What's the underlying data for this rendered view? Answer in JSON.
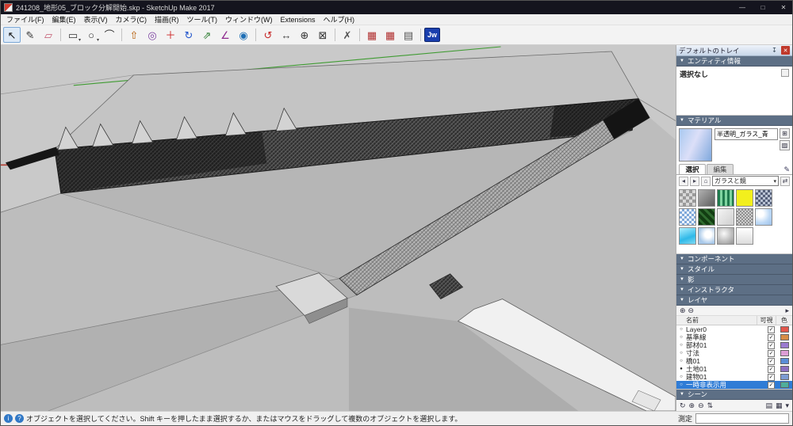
{
  "window": {
    "title": "241208_地形05_ブロック分解開始.skp - SketchUp Make 2017",
    "controls": {
      "minimize": "—",
      "maximize": "□",
      "close": "✕"
    }
  },
  "menu": {
    "items": [
      "ファイル(F)",
      "編集(E)",
      "表示(V)",
      "カメラ(C)",
      "描画(R)",
      "ツール(T)",
      "ウィンドウ(W)",
      "Extensions",
      "ヘルプ(H)"
    ]
  },
  "toolbar": {
    "items": [
      {
        "name": "select-tool",
        "glyph": "↖",
        "color": "#111111",
        "cls": "pressed",
        "inter": "true"
      },
      {
        "name": "line-tool",
        "glyph": "✎",
        "color": "#333333",
        "cls": "",
        "inter": "true"
      },
      {
        "name": "eraser-tool",
        "glyph": "▱",
        "color": "#c2566e",
        "cls": "",
        "inter": "true"
      },
      {
        "name": "toolbar-separator",
        "glyph": "",
        "color": "",
        "cls": "sep",
        "inter": "false"
      },
      {
        "name": "rectangle-tool",
        "glyph": "▭",
        "color": "#333333",
        "cls": "dd",
        "inter": "true"
      },
      {
        "name": "circle-tool",
        "glyph": "○",
        "color": "#333333",
        "cls": "dd",
        "inter": "true"
      },
      {
        "name": "arc-tool",
        "glyph": "⌒",
        "color": "#333333",
        "cls": "",
        "inter": "true"
      },
      {
        "name": "toolbar-separator",
        "glyph": "",
        "color": "",
        "cls": "sep",
        "inter": "false"
      },
      {
        "name": "pushpull-tool",
        "glyph": "⇧",
        "color": "#b35900",
        "cls": "",
        "inter": "true"
      },
      {
        "name": "offset-tool",
        "glyph": "◎",
        "color": "#7a3fa0",
        "cls": "",
        "inter": "true"
      },
      {
        "name": "move-tool",
        "glyph": "＋",
        "color": "#cc2222",
        "cls": "",
        "inter": "true"
      },
      {
        "name": "rotate-tool",
        "glyph": "↻",
        "color": "#2255cc",
        "cls": "",
        "inter": "true"
      },
      {
        "name": "scale-tool",
        "glyph": "⇗",
        "color": "#2e7d32",
        "cls": "",
        "inter": "true"
      },
      {
        "name": "tape-measure-tool",
        "glyph": "∠",
        "color": "#8e2a8e",
        "cls": "",
        "inter": "true"
      },
      {
        "name": "paint-bucket-tool",
        "glyph": "◉",
        "color": "#1f6fb5",
        "cls": "",
        "inter": "true"
      },
      {
        "name": "toolbar-separator",
        "glyph": "",
        "color": "",
        "cls": "sep",
        "inter": "false"
      },
      {
        "name": "orbit-tool",
        "glyph": "↺",
        "color": "#c62828",
        "cls": "",
        "inter": "true"
      },
      {
        "name": "pan-tool",
        "glyph": "↔",
        "color": "#444444",
        "cls": "",
        "inter": "true"
      },
      {
        "name": "zoom-tool",
        "glyph": "⊕",
        "color": "#333333",
        "cls": "",
        "inter": "true"
      },
      {
        "name": "zoom-extents-tool",
        "glyph": "⊠",
        "color": "#333333",
        "cls": "",
        "inter": "true"
      },
      {
        "name": "toolbar-separator",
        "glyph": "",
        "color": "",
        "cls": "sep",
        "inter": "false"
      },
      {
        "name": "delete-guides-tool",
        "glyph": "✗",
        "color": "#555555",
        "cls": "",
        "inter": "true"
      },
      {
        "name": "toolbar-separator",
        "glyph": "",
        "color": "",
        "cls": "sep",
        "inter": "false"
      },
      {
        "name": "plugin-cube-icon",
        "glyph": "▦",
        "color": "#b03030",
        "cls": "",
        "inter": "true"
      },
      {
        "name": "plugin-cube-icon-2",
        "glyph": "▦",
        "color": "#b03030",
        "cls": "",
        "inter": "true"
      },
      {
        "name": "export-icon",
        "glyph": "▤",
        "color": "#555555",
        "cls": "",
        "inter": "true"
      },
      {
        "name": "toolbar-separator",
        "glyph": "",
        "color": "",
        "cls": "sep",
        "inter": "false"
      },
      {
        "name": "jw-cad-button",
        "glyph": "Jw",
        "color": "#ffffff",
        "cls": "jw",
        "inter": "true"
      }
    ]
  },
  "tray": {
    "title": "デフォルトのトレイ",
    "entity": {
      "title": "エンティティ情報",
      "value": "選択なし"
    },
    "materials": {
      "title": "マテリアル",
      "name": "半透明_ガラス_青",
      "tab_select": "選択",
      "tab_edit": "編集",
      "category": "ガラスと鏡",
      "swatches": [
        {
          "cls": "sw1"
        },
        {
          "cls": "sw2"
        },
        {
          "cls": "sw3"
        },
        {
          "cls": "sw4"
        },
        {
          "cls": "sw5"
        },
        {
          "cls": "sw6"
        },
        {
          "cls": "sw7"
        },
        {
          "cls": "sw8"
        },
        {
          "cls": "sw9"
        },
        {
          "cls": "sw10"
        },
        {
          "cls": "sw11"
        },
        {
          "cls": "sw12"
        },
        {
          "cls": "sw13"
        },
        {
          "cls": "sw14"
        }
      ]
    },
    "collapsed": [
      {
        "name": "components-section-header",
        "label": "コンポーネント",
        "inter": "true"
      },
      {
        "name": "styles-section-header",
        "label": "スタイル",
        "inter": "true"
      },
      {
        "name": "shadows-section-header",
        "label": "影",
        "inter": "true"
      },
      {
        "name": "instructor-section-header",
        "label": "インストラクタ",
        "inter": "true"
      }
    ],
    "layers": {
      "title": "レイヤ",
      "columns": {
        "name": "名前",
        "visible": "可視",
        "color": "色"
      },
      "tools": [
        {
          "name": "add-layer-button",
          "glyph": "⊕",
          "cls": "",
          "inter": "true"
        },
        {
          "name": "remove-layer-button",
          "glyph": "⊖",
          "cls": "",
          "inter": "true"
        },
        {
          "name": "layer-options-button",
          "glyph": "▸",
          "cls": "push-right",
          "inter": "true"
        }
      ],
      "rows": [
        {
          "rowname": "layer-row-layer0",
          "name": "Layer0",
          "radio": "○",
          "check": "✓",
          "color": "#e2574c",
          "cls": ""
        },
        {
          "rowname": "layer-row-kijunsen",
          "name": "基準線",
          "radio": "○",
          "check": "✓",
          "color": "#d78d46",
          "cls": ""
        },
        {
          "rowname": "layer-row-buzai01",
          "name": "部材01",
          "radio": "○",
          "check": "✓",
          "color": "#9b7bd0",
          "cls": ""
        },
        {
          "rowname": "layer-row-sunpou",
          "name": "寸法",
          "radio": "○",
          "check": "✓",
          "color": "#de9ed6",
          "cls": ""
        },
        {
          "rowname": "layer-row-hashi01",
          "name": "橋01",
          "radio": "○",
          "check": "✓",
          "color": "#5b8ed6",
          "cls": ""
        },
        {
          "rowname": "layer-row-tochi01",
          "name": "土地01",
          "radio": "●",
          "check": "✓",
          "color": "#8d6fc0",
          "cls": ""
        },
        {
          "rowname": "layer-row-tatemono01",
          "name": "建物01",
          "radio": "○",
          "check": "✓",
          "color": "#7d9bd2",
          "cls": ""
        },
        {
          "rowname": "layer-row-ichiji-hihyouji",
          "name": "一時非表示用",
          "radio": "○",
          "check": "✓",
          "color": "#4fae9b",
          "cls": "selected"
        }
      ]
    },
    "scenes": {
      "title": "シーン",
      "tools": [
        {
          "name": "scene-update-button",
          "glyph": "↻",
          "cls": "",
          "inter": "true"
        },
        {
          "name": "scene-add-button",
          "glyph": "⊕",
          "cls": "",
          "inter": "true"
        },
        {
          "name": "scene-remove-button",
          "glyph": "⊖",
          "cls": "",
          "inter": "true"
        },
        {
          "name": "scene-move-button",
          "glyph": "⇅",
          "cls": "",
          "inter": "true"
        },
        {
          "name": "scene-view-list-button",
          "glyph": "▤",
          "cls": "push-right",
          "inter": "true"
        },
        {
          "name": "scene-view-thumbs-button",
          "glyph": "▦",
          "cls": "",
          "inter": "true"
        },
        {
          "name": "scene-options-button",
          "glyph": "▾",
          "cls": "",
          "inter": "true"
        }
      ]
    }
  },
  "statusbar": {
    "message": "オブジェクトを選択してください。Shift キーを押したまま選択するか、またはマウスをドラッグして複数のオブジェクトを選択します。",
    "measure_label": "測定",
    "measure_value": ""
  }
}
